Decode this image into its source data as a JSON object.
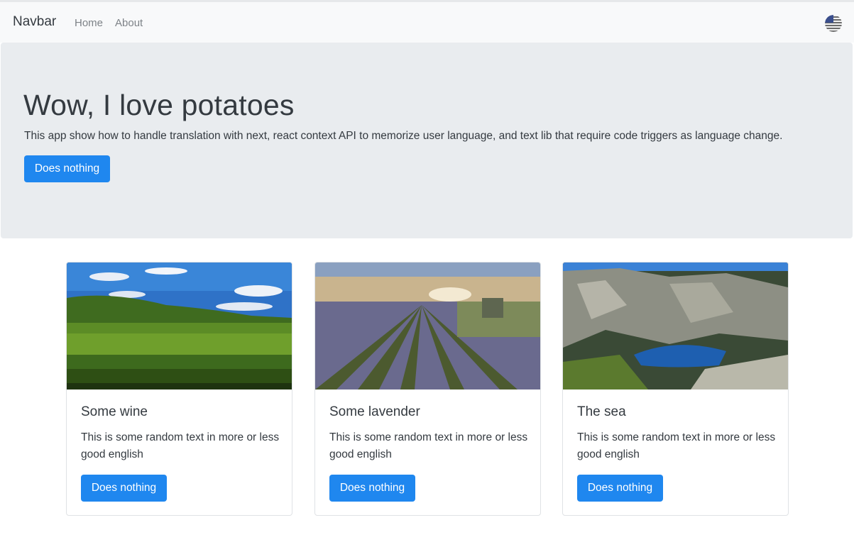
{
  "navbar": {
    "brand": "Navbar",
    "links": [
      {
        "label": "Home"
      },
      {
        "label": "About"
      }
    ],
    "language_icon": "flag-icon"
  },
  "hero": {
    "title": "Wow, I love potatoes",
    "lead": "This app show how to handle translation with next, react context API to memorize user language, and text lib that require code triggers as language change.",
    "button_label": "Does nothing"
  },
  "cards": [
    {
      "title": "Some wine",
      "text": "This is some random text in more or less good english",
      "button_label": "Does nothing",
      "image": "vineyard-image"
    },
    {
      "title": "Some lavender",
      "text": "This is some random text in more or less good english",
      "button_label": "Does nothing",
      "image": "lavender-field-image"
    },
    {
      "title": "The sea",
      "text": "This is some random text in more or less good english",
      "button_label": "Does nothing",
      "image": "sea-cliffs-image"
    }
  ],
  "colors": {
    "primary": "#1f87ef",
    "jumbotron": "#e9ecef",
    "navbar": "#f8f9fa"
  }
}
